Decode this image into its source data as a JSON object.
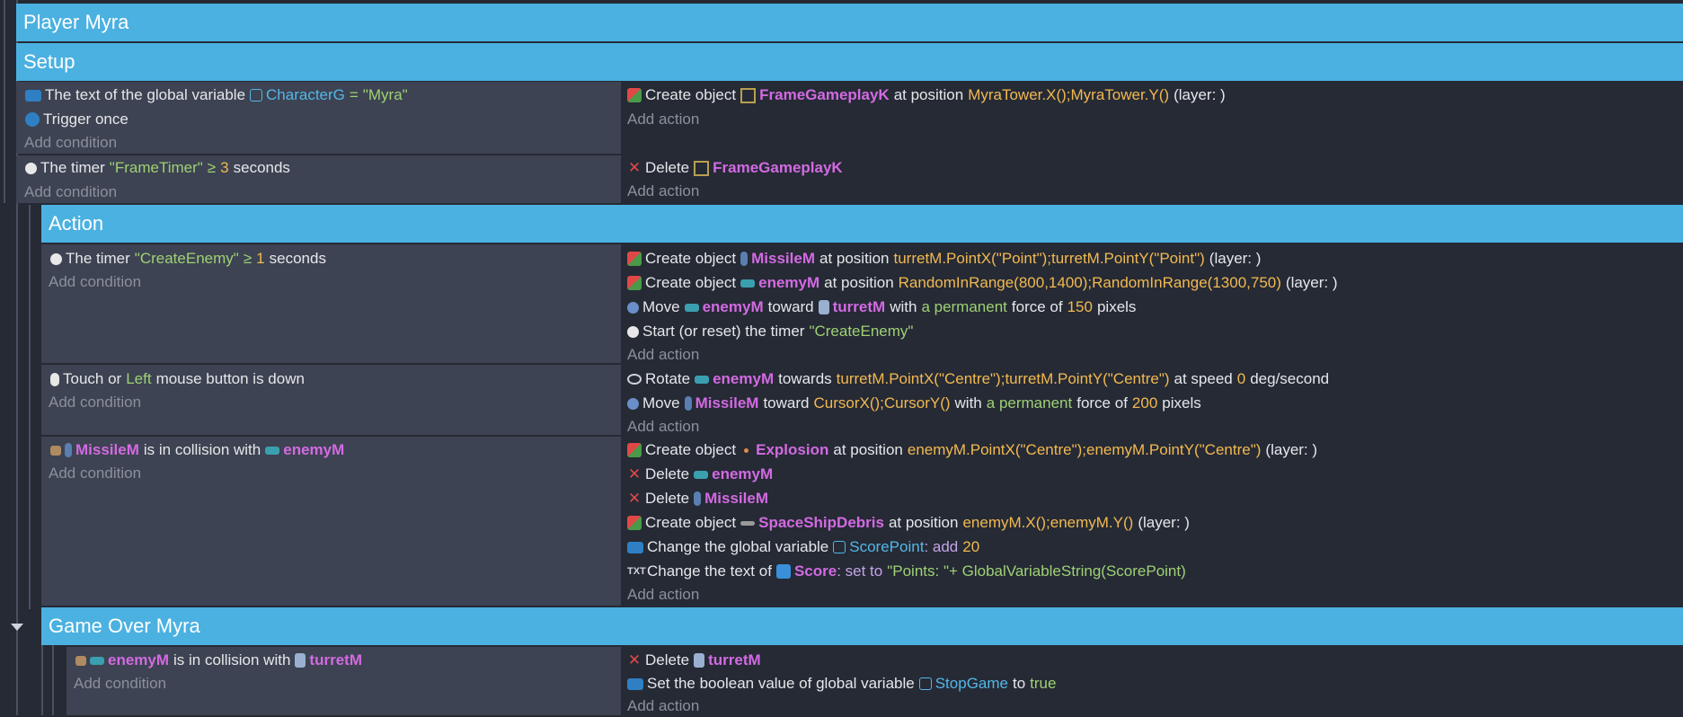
{
  "groups": {
    "player": "Player Myra",
    "setup": "Setup",
    "action": "Action",
    "gameover": "Game Over Myra"
  },
  "add_condition": "Add condition",
  "add_action": "Add action",
  "setup": {
    "e1": {
      "c1": {
        "t1": "The text of the global variable",
        "var": "CharacterG",
        "op": "=",
        "val": "\"Myra\""
      },
      "c2": {
        "t1": "Trigger once"
      },
      "a1": {
        "t1": "Create object",
        "obj": "FrameGameplayK",
        "t2": "at position",
        "pos": "MyraTower.X();MyraTower.Y()",
        "t3": "(layer: )"
      }
    },
    "e2": {
      "c1": {
        "t1": "The timer",
        "timer": "\"FrameTimer\"",
        "op": "≥",
        "num": "3",
        "t2": "seconds"
      },
      "a1": {
        "t1": "Delete",
        "obj": "FrameGameplayK"
      }
    }
  },
  "action": {
    "e1": {
      "c1": {
        "t1": "The timer",
        "timer": "\"CreateEnemy\"",
        "op": "≥",
        "num": "1",
        "t2": "seconds"
      },
      "a1": {
        "t1": "Create object",
        "obj": "MissileM",
        "t2": "at position",
        "pos": "turretM.PointX(\"Point\");turretM.PointY(\"Point\")",
        "t3": "(layer: )"
      },
      "a2": {
        "t1": "Create object",
        "obj": "enemyM",
        "t2": "at position",
        "pos": "RandomInRange(800,1400);RandomInRange(1300,750)",
        "t3": "(layer: )"
      },
      "a3": {
        "t1": "Move",
        "obj": "enemyM",
        "t2": "toward",
        "obj2": "turretM",
        "t3": "with",
        "kw": "a permanent",
        "t4": "force of",
        "num": "150",
        "t5": "pixels"
      },
      "a4": {
        "t1": "Start (or reset) the timer",
        "timer": "\"CreateEnemy\""
      }
    },
    "e2": {
      "c1": {
        "t1": "Touch or",
        "kw": "Left",
        "t2": "mouse button is down"
      },
      "a1": {
        "t1": "Rotate",
        "obj": "enemyM",
        "t2": "towards",
        "pos": "turretM.PointX(\"Centre\");turretM.PointY(\"Centre\")",
        "t3": "at speed",
        "num": "0",
        "t4": "deg/second"
      },
      "a2": {
        "t1": "Move",
        "obj": "MissileM",
        "t2": "toward",
        "pos": "CursorX();CursorY()",
        "t3": "with",
        "kw": "a permanent",
        "t4": "force of",
        "num": "200",
        "t5": "pixels"
      }
    },
    "e3": {
      "c1": {
        "obj": "MissileM",
        "t1": "is in collision with",
        "obj2": "enemyM"
      },
      "a1": {
        "t1": "Create object",
        "obj": "Explosion",
        "t2": "at position",
        "pos": "enemyM.PointX(\"Centre\");enemyM.PointY(\"Centre\")",
        "t3": "(layer: )"
      },
      "a2": {
        "t1": "Delete",
        "obj": "enemyM"
      },
      "a3": {
        "t1": "Delete",
        "obj": "MissileM"
      },
      "a4": {
        "t1": "Create object",
        "obj": "SpaceShipDebris",
        "t2": "at position",
        "pos": "enemyM.X();enemyM.Y()",
        "t3": "(layer: )"
      },
      "a5": {
        "t1": "Change the global variable",
        "var": "ScorePoint",
        "op": ": add",
        "num": "20"
      },
      "a6": {
        "t1": "Change the text of",
        "obj": "Score",
        "op": ": set to",
        "val": "\"Points: \"+ GlobalVariableString(ScorePoint)"
      }
    }
  },
  "gameover": {
    "e1": {
      "c1": {
        "obj": "enemyM",
        "t1": "is in collision with",
        "obj2": "turretM"
      },
      "a1": {
        "t1": "Delete",
        "obj": "turretM"
      },
      "a2": {
        "t1": "Set the boolean value of global variable",
        "var": "StopGame",
        "t2": "to",
        "kw": "true"
      }
    }
  },
  "icons": {
    "variable": "variable-icon",
    "once": "trigger-once-icon",
    "create": "create-object-icon",
    "delete": "delete-icon",
    "timer": "timer-icon",
    "mouse": "mouse-icon",
    "collision": "collision-icon",
    "move": "move-icon",
    "rotate": "rotate-icon",
    "text": "text-icon",
    "frame": "frame-object-icon",
    "missile": "missile-object-icon",
    "enemy": "enemy-object-icon",
    "turret": "turret-object-icon",
    "explosion": "explosion-object-icon",
    "debris": "debris-object-icon",
    "score": "score-object-icon"
  },
  "colors": {
    "group_header": "#4bb1e1",
    "condition_bg": "#3d4352",
    "action_bg": "#252a35",
    "object": "#d36ae2",
    "string": "#9fd174",
    "number": "#f3b94f",
    "variable": "#53b7e8"
  }
}
